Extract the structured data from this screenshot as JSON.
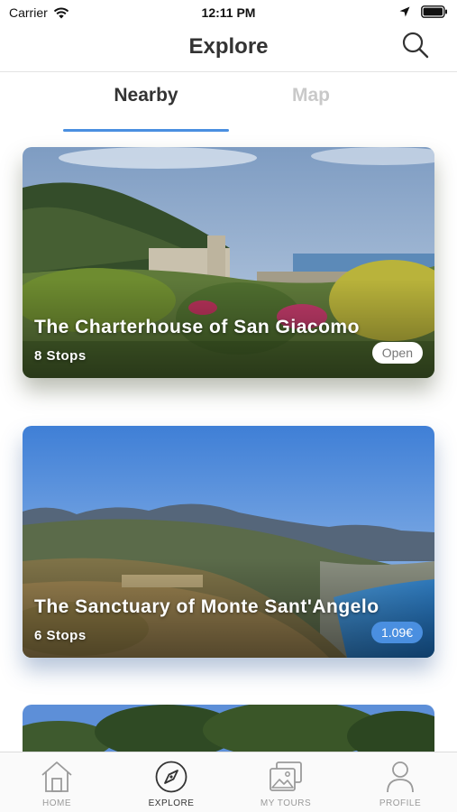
{
  "status_bar": {
    "carrier": "Carrier",
    "time": "12:11 PM"
  },
  "header": {
    "title": "Explore",
    "search_icon": "search-icon"
  },
  "tabs": [
    {
      "label": "Nearby",
      "active": true
    },
    {
      "label": "Map",
      "active": false
    }
  ],
  "tours": [
    {
      "title": "The Charterhouse of San Giacomo",
      "stops": "8 Stops",
      "badge": "Open",
      "badge_kind": "open"
    },
    {
      "title": "The Sanctuary of Monte Sant'Angelo",
      "stops": "6 Stops",
      "badge": "1.09€",
      "badge_kind": "price"
    },
    {
      "title": "",
      "stops": "",
      "badge": ""
    }
  ],
  "tab_bar": [
    {
      "label": "HOME",
      "icon": "home-icon",
      "active": false
    },
    {
      "label": "EXPLORE",
      "icon": "compass-icon",
      "active": true
    },
    {
      "label": "MY TOURS",
      "icon": "photos-icon",
      "active": false
    },
    {
      "label": "PROFILE",
      "icon": "profile-icon",
      "active": false
    }
  ],
  "colors": {
    "accent": "#4a8fe0",
    "inactive_tab": "#c9c9c9"
  }
}
